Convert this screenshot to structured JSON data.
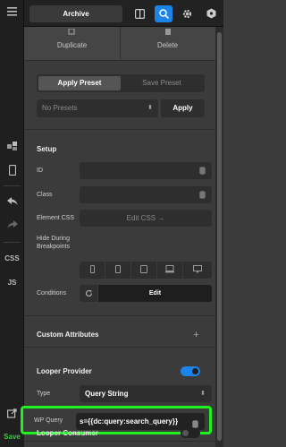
{
  "toolbar": {
    "archive_label": "Archive",
    "icons": [
      "columns-icon",
      "search-icon",
      "gear-icon",
      "hexagon-icon"
    ]
  },
  "rail": {
    "css_label": "CSS",
    "js_label": "JS",
    "save_label": "Save"
  },
  "actions": {
    "duplicate_label": "Duplicate",
    "delete_label": "Delete"
  },
  "presets": {
    "tabs": [
      "Apply Preset",
      "Save Preset"
    ],
    "active_tab": "Apply Preset",
    "select_value": "No Presets",
    "apply_label": "Apply"
  },
  "setup": {
    "heading": "Setup",
    "id_label": "ID",
    "class_label": "Class",
    "element_css_label": "Element CSS",
    "edit_css_label": "Edit CSS →",
    "hide_label_1": "Hide During",
    "hide_label_2": "Breakpoints",
    "conditions_label": "Conditions",
    "conditions_edit_label": "Edit"
  },
  "custom_attributes": {
    "heading": "Custom Attributes"
  },
  "looper_provider": {
    "heading": "Looper Provider",
    "enabled": true,
    "type_label": "Type",
    "type_value": "Query String",
    "wp_query_label": "WP Query",
    "wp_query_value": "s={{dc:query:search_query}}"
  },
  "looper_consumer": {
    "heading": "Looper Consumer",
    "enabled": false
  },
  "colors": {
    "accent": "#1c84e8",
    "highlight": "#1ff21f",
    "save": "#41c741"
  }
}
